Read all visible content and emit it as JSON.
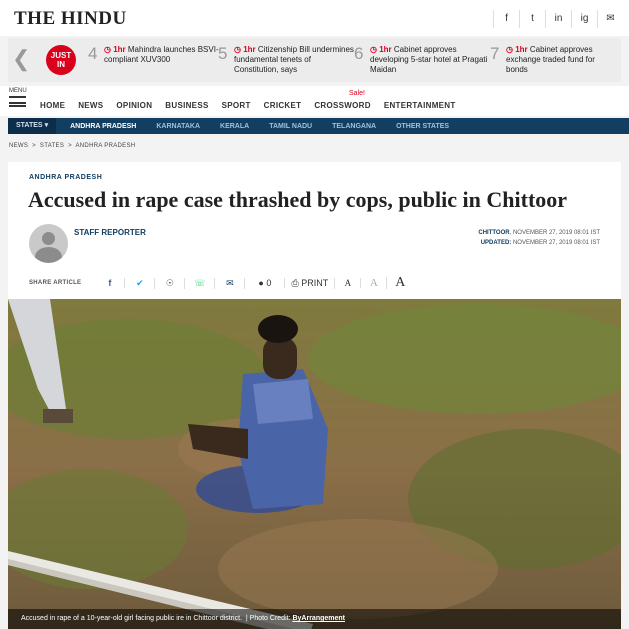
{
  "masthead": {
    "logo": "THE HINDU",
    "social": [
      "f",
      "t",
      "in",
      "ig",
      "✉"
    ]
  },
  "ticker": {
    "badge": "JUST IN",
    "items": [
      {
        "num": "4",
        "time": "1hr",
        "text": "Mahindra launches BSVI-compliant XUV300"
      },
      {
        "num": "5",
        "time": "1hr",
        "text": "Citizenship Bill undermines fundamental tenets of Constitution, says"
      },
      {
        "num": "6",
        "time": "1hr",
        "text": "Cabinet approves developing 5-star hotel at Pragati Maidan"
      },
      {
        "num": "7",
        "time": "1hr",
        "text": "Cabinet approves exchange traded fund for bonds"
      }
    ]
  },
  "nav": {
    "menu_label": "MENU",
    "items": [
      "HOME",
      "NEWS",
      "OPINION",
      "BUSINESS",
      "SPORT",
      "CRICKET",
      "CROSSWORD",
      "ENTERTAINMENT"
    ],
    "sale_badge": "Sale!"
  },
  "states": {
    "lead": "STATES",
    "items": [
      "ANDHRA PRADESH",
      "KARNATAKA",
      "KERALA",
      "TAMIL NADU",
      "TELANGANA",
      "OTHER STATES"
    ]
  },
  "breadcrumb": {
    "items": [
      "NEWS",
      "STATES",
      "ANDHRA PRADESH"
    ],
    "sep": ">"
  },
  "article": {
    "kicker": "ANDHRA PRADESH",
    "headline": "Accused in rape case thrashed by cops, public in Chittoor",
    "author": "STAFF REPORTER",
    "location": "CHITTOOR",
    "published": ", NOVEMBER 27, 2019 08:01 IST",
    "updated_label": "UPDATED:",
    "updated": "NOVEMBER 27, 2019 08:01 IST"
  },
  "share": {
    "label": "SHARE ARTICLE",
    "comment_count": "0",
    "print_label": "PRINT",
    "font_sizes": [
      "A",
      "A",
      "A"
    ]
  },
  "photo": {
    "caption": "Accused in rape of a 10-year-old girl facing public ire in Chittoor district.",
    "credit_label": "| Photo Credit:",
    "credit": "ByArrangement"
  },
  "colors": {
    "accent": "#d9001b",
    "navy": "#123e61"
  }
}
